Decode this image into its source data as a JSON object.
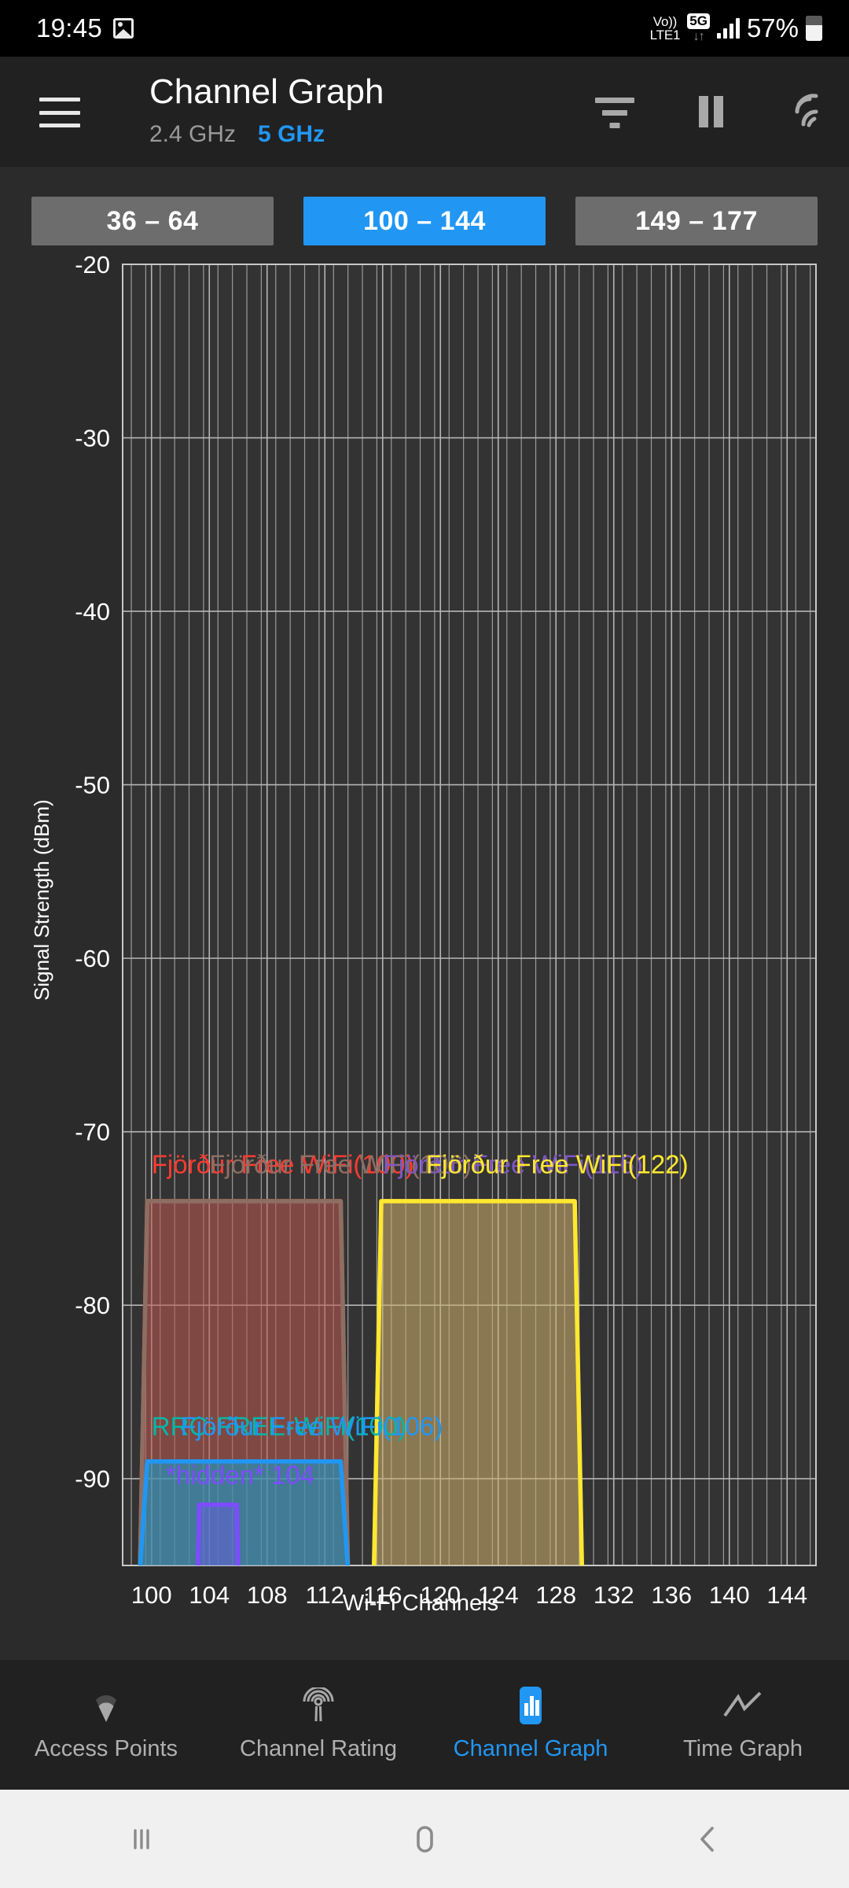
{
  "status_bar": {
    "time": "19:45",
    "image_icon": "image-icon",
    "volte_line1": "Vo))",
    "volte_line2": "LTE1",
    "network_badge": "5G",
    "data_arrows": "↓↑",
    "signal_icon": "signal-bars-icon",
    "battery_percent": "57%",
    "battery_icon": "battery-icon"
  },
  "app_bar": {
    "menu_icon": "hamburger-menu-icon",
    "title": "Channel Graph",
    "bands": [
      {
        "label": "2.4 GHz",
        "active": false
      },
      {
        "label": "5 GHz",
        "active": true
      }
    ],
    "filter_icon": "filter-icon",
    "pause_icon": "pause-icon",
    "scan_icon": "wifi-scan-icon"
  },
  "channel_ranges": [
    {
      "label": "36 – 64",
      "selected": false
    },
    {
      "label": "100 – 144",
      "selected": true
    },
    {
      "label": "149 – 177",
      "selected": false
    }
  ],
  "chart_data": {
    "type": "area",
    "title": "",
    "xlabel": "Wi-Fi Channels",
    "ylabel": "Signal Strength (dBm)",
    "xlim": [
      98,
      146
    ],
    "ylim": [
      -95,
      -20
    ],
    "xticks": [
      100,
      104,
      108,
      112,
      116,
      120,
      124,
      128,
      132,
      136,
      140,
      144
    ],
    "yticks": [
      -20,
      -30,
      -40,
      -50,
      -60,
      -70,
      -80,
      -90
    ],
    "grid": true,
    "legend_position": "inline-labels",
    "series": [
      {
        "name": "Fjörður Free WiFi(100)",
        "label": "Fjörður Free WiFi(100)",
        "color": "#ff3b30",
        "channel": 100,
        "center": 106.5,
        "level": -74,
        "start": 99.2,
        "end": 113.6,
        "label_x": 100,
        "label_y": -72.4
      },
      {
        "name": "Fjörður Free WiFi(106)",
        "label": "Fjörður Free WiFi(106)",
        "color": "#8d6e63",
        "channel": 106,
        "center": 106.5,
        "level": -74,
        "start": 99.2,
        "end": 113.6,
        "label_x": 104,
        "label_y": -72.4
      },
      {
        "name": "Fjörður Free WiFi(116)",
        "label": "Fjörður Free WiFi(116)",
        "color": "#7e57c2",
        "channel": 116,
        "center": 122.5,
        "level": -74,
        "start": 115.4,
        "end": 129.8,
        "label_x": 116,
        "label_y": -72.4
      },
      {
        "name": "Fjörður Free WiFi(122)",
        "label": "Fjörður Free WiFi(122)",
        "color": "#ffe82e",
        "channel": 122,
        "center": 122.5,
        "level": -74,
        "start": 115.4,
        "end": 129.8,
        "label_x": 119,
        "label_y": -72.4
      },
      {
        "name": "RRC-FREE-WiFi(100)",
        "label": "RRC-FREE-WiFi(100)",
        "color": "#00b8a9",
        "channel": 100,
        "center": 106.5,
        "level": -89,
        "start": 99.2,
        "end": 113.6,
        "label_x": 100,
        "label_y": -87.5
      },
      {
        "name": "Fjörður Free WiFi(106)b",
        "label": "Fjörður Free WiFi(106)",
        "color": "#2196f3",
        "channel": 106,
        "center": 106.5,
        "level": -89,
        "start": 99.2,
        "end": 113.6,
        "label_x": 102,
        "label_y": -87.5
      },
      {
        "name": "*hidden* 104",
        "label": "*hidden* 104",
        "color": "#7c4dff",
        "channel": 104,
        "center": 104,
        "level": -91.5,
        "start": 103.2,
        "end": 106.0,
        "label_x": 101,
        "label_y": -90.3
      }
    ]
  },
  "bottom_nav": [
    {
      "label": "Access Points",
      "icon": "access-point-icon",
      "selected": false
    },
    {
      "label": "Channel Rating",
      "icon": "antenna-icon",
      "selected": false
    },
    {
      "label": "Channel Graph",
      "icon": "bar-chart-icon",
      "selected": true
    },
    {
      "label": "Time Graph",
      "icon": "line-chart-icon",
      "selected": false
    }
  ],
  "android_nav": {
    "recents_icon": "recents-icon",
    "home_icon": "home-icon",
    "back_icon": "back-icon"
  },
  "colors": {
    "accent": "#2196f3",
    "app_bar_bg": "#212121",
    "page_bg": "#2b2b2b",
    "plot_bg": "#333333",
    "grid": "#9e9e9e"
  }
}
